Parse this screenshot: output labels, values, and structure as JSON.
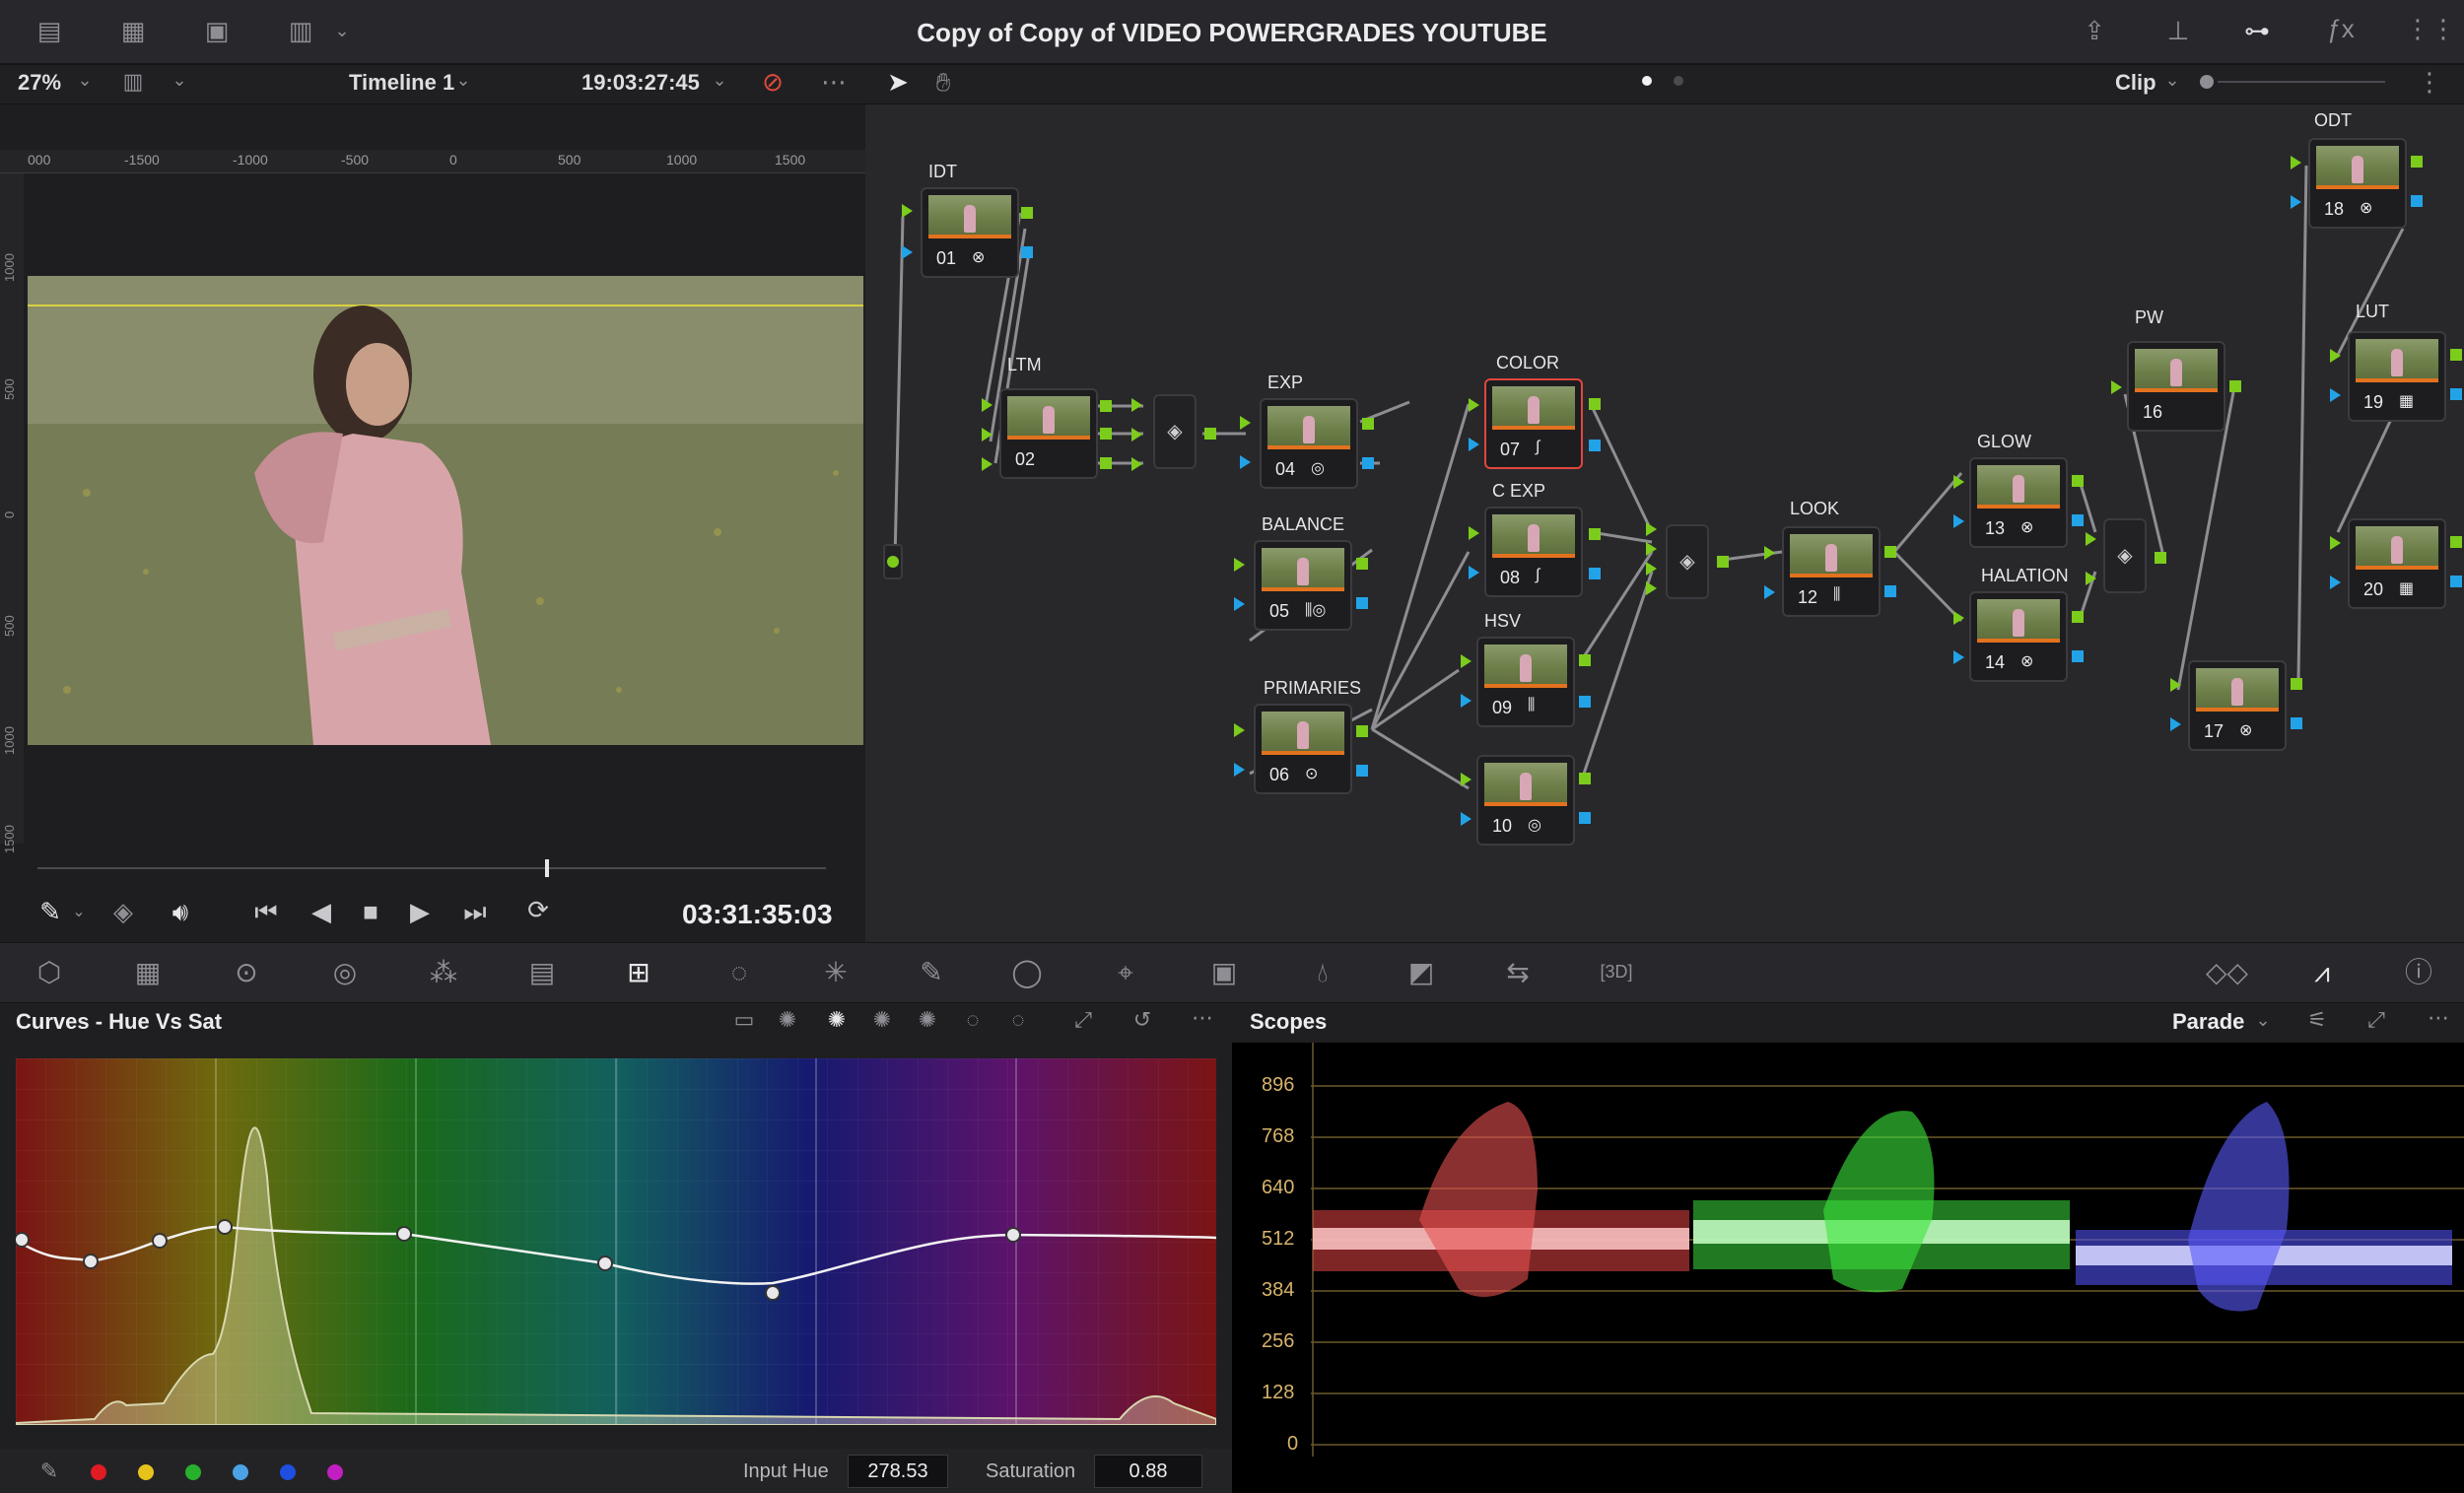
{
  "window": {
    "title": "Copy of Copy of VIDEO POWERGRADES YOUTUBE"
  },
  "viewer": {
    "zoom": "27%",
    "timeline": "Timeline 1",
    "timecode": "19:03:27:45",
    "playhead_timecode": "03:31:35:03",
    "ruler_ticks": [
      "000",
      "-1500",
      "-1000",
      "-500",
      "0",
      "500",
      "1000",
      "1500"
    ],
    "vruler_ticks": [
      "1000",
      "500",
      "0",
      "500",
      "1000",
      "1500"
    ],
    "scrubber_position_fraction": 0.64
  },
  "node_editor": {
    "mode": "Clip",
    "nodes": [
      {
        "label": "IDT",
        "num": "01",
        "icon": "fx-icon"
      },
      {
        "label": "LTM",
        "num": "02",
        "icon": ""
      },
      {
        "label": "EXP",
        "num": "04",
        "icon": "hdr-wheel-icon"
      },
      {
        "label": "BALANCE",
        "num": "05",
        "icon": "bars-hdr-icon"
      },
      {
        "label": "PRIMARIES",
        "num": "06",
        "icon": "wheel-icon"
      },
      {
        "label": "COLOR",
        "num": "07",
        "icon": "curve-icon"
      },
      {
        "label": "C EXP",
        "num": "08",
        "icon": "curve-icon"
      },
      {
        "label": "HSV",
        "num": "09",
        "icon": "bars-icon"
      },
      {
        "label": "",
        "num": "10",
        "icon": "hdr-wheel-icon"
      },
      {
        "label": "LOOK",
        "num": "12",
        "icon": "bars-icon"
      },
      {
        "label": "GLOW",
        "num": "13",
        "icon": "fx-icon"
      },
      {
        "label": "HALATION",
        "num": "14",
        "icon": "fx-icon"
      },
      {
        "label": "PW",
        "num": "16",
        "icon": ""
      },
      {
        "label": "",
        "num": "17",
        "icon": "fx-icon"
      },
      {
        "label": "ODT",
        "num": "18",
        "icon": "fx-icon"
      },
      {
        "label": "LUT",
        "num": "19",
        "icon": "lut-icon"
      },
      {
        "label": "",
        "num": "20",
        "icon": "lut-icon"
      }
    ]
  },
  "curves": {
    "title": "Curves - Hue Vs Sat",
    "input_hue_label": "Input Hue",
    "input_hue_value": "278.53",
    "saturation_label": "Saturation",
    "saturation_value": "0.88",
    "swatches": [
      "#e01b24",
      "#e6c31a",
      "#27b02c",
      "#4aa3e6",
      "#1e4fe0",
      "#c21fc2"
    ]
  },
  "scopes": {
    "title": "Scopes",
    "mode": "Parade",
    "scale_labels": [
      "896",
      "768",
      "640",
      "512",
      "384",
      "256",
      "128",
      "0"
    ]
  }
}
